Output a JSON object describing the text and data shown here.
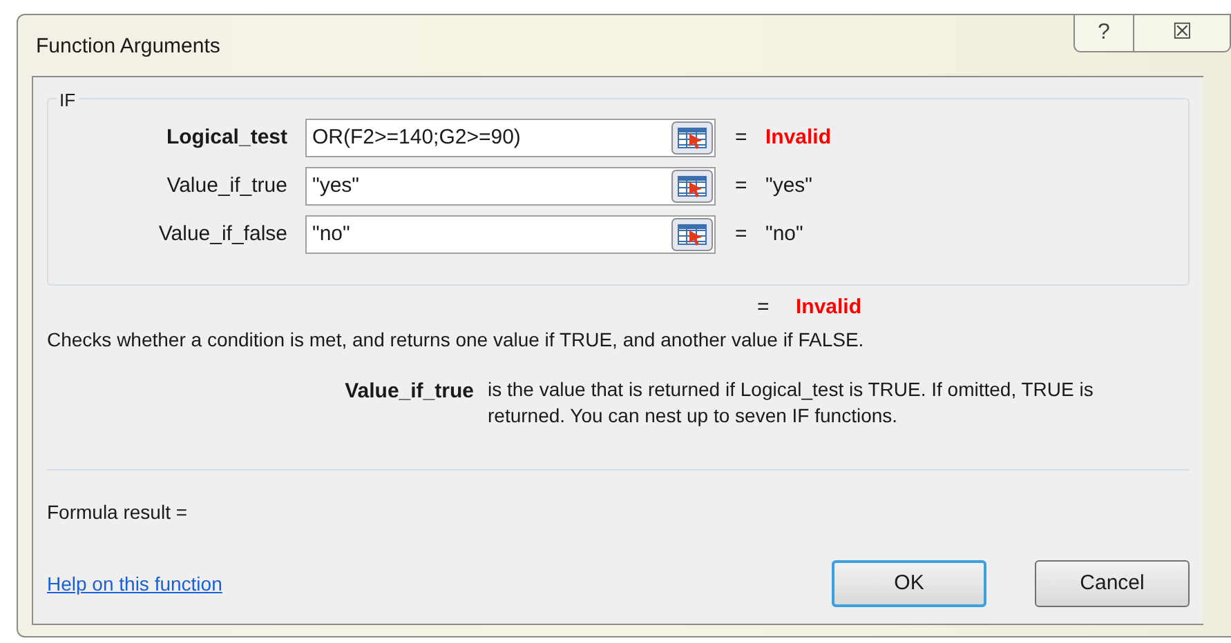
{
  "window": {
    "title": "Function Arguments",
    "buttons": [
      {
        "kind": "help",
        "label": "?"
      },
      {
        "kind": "close",
        "label": "☒"
      }
    ]
  },
  "group": {
    "title": "IF",
    "arguments": [
      {
        "label": "Logical_test",
        "value": "OR(F2>=140;G2>=90)",
        "result": "Invalid",
        "invalid": true,
        "selected": true
      },
      {
        "label": "Value_if_true",
        "value": "\"yes\"",
        "result": "\"yes\"",
        "invalid": false,
        "selected": false
      },
      {
        "label": "Value_if_false",
        "value": "\"no\"",
        "result": "\"no\"",
        "invalid": false,
        "selected": false
      }
    ]
  },
  "overall_result": {
    "equals": "=",
    "value": "Invalid",
    "invalid": true
  },
  "description": "Checks whether a condition is met, and returns one value if TRUE, and another value if FALSE.",
  "argument_help": {
    "name": "Value_if_true",
    "text": "is the value that is returned if Logical_test is TRUE. If omitted, TRUE is returned. You can nest up to seven IF functions."
  },
  "formula_result": "Formula result =",
  "help_link": "Help on this function",
  "buttons": [
    {
      "label": "OK",
      "default": true
    },
    {
      "label": "Cancel",
      "default": false
    }
  ]
}
